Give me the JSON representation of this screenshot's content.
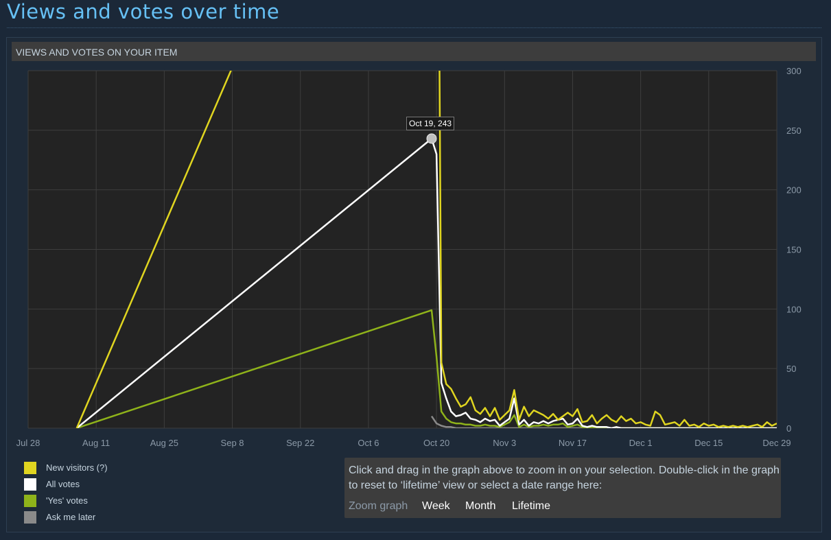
{
  "page": {
    "title": "Views and votes over time",
    "panel_title": "VIEWS AND VOTES ON YOUR ITEM"
  },
  "tooltip": {
    "text": "Oct 19, 243"
  },
  "legend": [
    {
      "label": "New visitors (?)",
      "color": "#e0d520"
    },
    {
      "label": "All votes",
      "color": "#ffffff"
    },
    {
      "label": "'Yes' votes",
      "color": "#8fb31a"
    },
    {
      "label": "Ask me later",
      "color": "#8a8a8a"
    }
  ],
  "zoom": {
    "instructions": "Click and drag in the graph above to zoom in on your selection. Double-click in the graph to reset to ‘lifetime’ view or select a date range here:",
    "label": "Zoom graph",
    "options": [
      "Week",
      "Month",
      "Lifetime"
    ]
  },
  "chart_data": {
    "type": "line",
    "x_type": "date",
    "x_range": [
      "2013-07-28",
      "2013-12-29"
    ],
    "x_tick_labels": [
      "Jul 28",
      "Aug 11",
      "Aug 25",
      "Sep 8",
      "Sep 22",
      "Oct 6",
      "Oct 20",
      "Nov 3",
      "Nov 17",
      "Dec 1",
      "Dec 15",
      "Dec 29"
    ],
    "ylim": [
      0,
      300
    ],
    "y_ticks": [
      0,
      50,
      100,
      150,
      200,
      250,
      300
    ],
    "grid": true,
    "highlight": {
      "series": "All votes",
      "x": "2013-10-19",
      "y": 243
    },
    "series": [
      {
        "name": "New visitors (?)",
        "color": "#e0d520",
        "points": [
          [
            "2013-08-07",
            0
          ],
          [
            "2013-10-20",
            700
          ],
          [
            "2013-10-21",
            55
          ],
          [
            "2013-10-22",
            37
          ],
          [
            "2013-10-23",
            33
          ],
          [
            "2013-10-24",
            25
          ],
          [
            "2013-10-25",
            18
          ],
          [
            "2013-10-26",
            20
          ],
          [
            "2013-10-27",
            26
          ],
          [
            "2013-10-28",
            15
          ],
          [
            "2013-10-29",
            12
          ],
          [
            "2013-10-30",
            17
          ],
          [
            "2013-10-31",
            10
          ],
          [
            "2013-11-01",
            17
          ],
          [
            "2013-11-02",
            7
          ],
          [
            "2013-11-03",
            11
          ],
          [
            "2013-11-04",
            15
          ],
          [
            "2013-11-05",
            32
          ],
          [
            "2013-11-06",
            7
          ],
          [
            "2013-11-07",
            18
          ],
          [
            "2013-11-08",
            10
          ],
          [
            "2013-11-09",
            15
          ],
          [
            "2013-11-10",
            13
          ],
          [
            "2013-11-11",
            11
          ],
          [
            "2013-11-12",
            8
          ],
          [
            "2013-11-13",
            12
          ],
          [
            "2013-11-14",
            7
          ],
          [
            "2013-11-15",
            10
          ],
          [
            "2013-11-16",
            13
          ],
          [
            "2013-11-17",
            10
          ],
          [
            "2013-11-18",
            16
          ],
          [
            "2013-11-19",
            5
          ],
          [
            "2013-11-20",
            6
          ],
          [
            "2013-11-21",
            11
          ],
          [
            "2013-11-22",
            4
          ],
          [
            "2013-11-23",
            8
          ],
          [
            "2013-11-24",
            11
          ],
          [
            "2013-11-25",
            7
          ],
          [
            "2013-11-26",
            5
          ],
          [
            "2013-11-27",
            10
          ],
          [
            "2013-11-28",
            6
          ],
          [
            "2013-11-29",
            8
          ],
          [
            "2013-11-30",
            4
          ],
          [
            "2013-12-01",
            5
          ],
          [
            "2013-12-02",
            3
          ],
          [
            "2013-12-03",
            2
          ],
          [
            "2013-12-04",
            14
          ],
          [
            "2013-12-05",
            11
          ],
          [
            "2013-12-06",
            3
          ],
          [
            "2013-12-07",
            4
          ],
          [
            "2013-12-08",
            5
          ],
          [
            "2013-12-09",
            2
          ],
          [
            "2013-12-10",
            7
          ],
          [
            "2013-12-11",
            2
          ],
          [
            "2013-12-12",
            3
          ],
          [
            "2013-12-13",
            1
          ],
          [
            "2013-12-14",
            4
          ],
          [
            "2013-12-15",
            2
          ],
          [
            "2013-12-16",
            3
          ],
          [
            "2013-12-17",
            1
          ],
          [
            "2013-12-18",
            2
          ],
          [
            "2013-12-19",
            1
          ],
          [
            "2013-12-20",
            2
          ],
          [
            "2013-12-21",
            1
          ],
          [
            "2013-12-22",
            2
          ],
          [
            "2013-12-23",
            1
          ],
          [
            "2013-12-24",
            2
          ],
          [
            "2013-12-25",
            3
          ],
          [
            "2013-12-26",
            1
          ],
          [
            "2013-12-27",
            5
          ],
          [
            "2013-12-28",
            2
          ],
          [
            "2013-12-29",
            4
          ]
        ]
      },
      {
        "name": "All votes",
        "color": "#ffffff",
        "points": [
          [
            "2013-08-07",
            0
          ],
          [
            "2013-10-19",
            243
          ],
          [
            "2013-10-20",
            230
          ],
          [
            "2013-10-21",
            38
          ],
          [
            "2013-10-22",
            25
          ],
          [
            "2013-10-23",
            14
          ],
          [
            "2013-10-24",
            10
          ],
          [
            "2013-10-25",
            11
          ],
          [
            "2013-10-26",
            13
          ],
          [
            "2013-10-27",
            8
          ],
          [
            "2013-10-28",
            7
          ],
          [
            "2013-10-29",
            5
          ],
          [
            "2013-10-30",
            8
          ],
          [
            "2013-10-31",
            6
          ],
          [
            "2013-11-01",
            7
          ],
          [
            "2013-11-02",
            2
          ],
          [
            "2013-11-03",
            5
          ],
          [
            "2013-11-04",
            8
          ],
          [
            "2013-11-05",
            25
          ],
          [
            "2013-11-06",
            3
          ],
          [
            "2013-11-07",
            7
          ],
          [
            "2013-11-08",
            2
          ],
          [
            "2013-11-09",
            5
          ],
          [
            "2013-11-10",
            4
          ],
          [
            "2013-11-11",
            6
          ],
          [
            "2013-11-12",
            4
          ],
          [
            "2013-11-13",
            6
          ],
          [
            "2013-11-14",
            7
          ],
          [
            "2013-11-15",
            8
          ],
          [
            "2013-11-16",
            3
          ],
          [
            "2013-11-17",
            4
          ],
          [
            "2013-11-18",
            8
          ],
          [
            "2013-11-19",
            2
          ],
          [
            "2013-11-20",
            1
          ],
          [
            "2013-11-21",
            2
          ],
          [
            "2013-11-22",
            1
          ],
          [
            "2013-11-23",
            1
          ],
          [
            "2013-11-24",
            1
          ],
          [
            "2013-11-25",
            0
          ],
          [
            "2013-11-26",
            1
          ],
          [
            "2013-11-27",
            0
          ],
          [
            "2013-11-28",
            0
          ],
          [
            "2013-11-29",
            0
          ],
          [
            "2013-12-29",
            0
          ]
        ]
      },
      {
        "name": "'Yes' votes",
        "color": "#8fb31a",
        "points": [
          [
            "2013-08-07",
            0
          ],
          [
            "2013-10-19",
            99
          ],
          [
            "2013-10-20",
            60
          ],
          [
            "2013-10-21",
            14
          ],
          [
            "2013-10-22",
            8
          ],
          [
            "2013-10-23",
            5
          ],
          [
            "2013-10-24",
            4
          ],
          [
            "2013-10-25",
            4
          ],
          [
            "2013-10-26",
            3
          ],
          [
            "2013-10-27",
            3
          ],
          [
            "2013-10-28",
            2
          ],
          [
            "2013-10-29",
            2
          ],
          [
            "2013-10-30",
            3
          ],
          [
            "2013-10-31",
            2
          ],
          [
            "2013-11-01",
            2
          ],
          [
            "2013-11-02",
            1
          ],
          [
            "2013-11-03",
            3
          ],
          [
            "2013-11-04",
            5
          ],
          [
            "2013-11-05",
            11
          ],
          [
            "2013-11-06",
            1
          ],
          [
            "2013-11-07",
            3
          ],
          [
            "2013-11-08",
            1
          ],
          [
            "2013-11-09",
            2
          ],
          [
            "2013-11-10",
            2
          ],
          [
            "2013-11-11",
            3
          ],
          [
            "2013-11-12",
            2
          ],
          [
            "2013-11-13",
            3
          ],
          [
            "2013-11-14",
            3
          ],
          [
            "2013-11-15",
            4
          ],
          [
            "2013-11-16",
            1
          ],
          [
            "2013-11-17",
            2
          ],
          [
            "2013-11-18",
            3
          ],
          [
            "2013-11-19",
            1
          ],
          [
            "2013-11-20",
            0
          ],
          [
            "2013-11-21",
            1
          ],
          [
            "2013-11-22",
            0
          ],
          [
            "2013-11-23",
            0
          ],
          [
            "2013-12-29",
            0
          ]
        ]
      },
      {
        "name": "Ask me later",
        "color": "#8a8a8a",
        "points": [
          [
            "2013-10-19",
            10
          ],
          [
            "2013-10-20",
            4
          ],
          [
            "2013-10-21",
            2
          ],
          [
            "2013-10-22",
            1
          ],
          [
            "2013-10-23",
            1
          ],
          [
            "2013-10-24",
            0
          ],
          [
            "2013-10-25",
            0
          ],
          [
            "2013-10-26",
            0
          ],
          [
            "2013-10-27",
            0
          ],
          [
            "2013-12-29",
            0
          ]
        ]
      }
    ]
  }
}
